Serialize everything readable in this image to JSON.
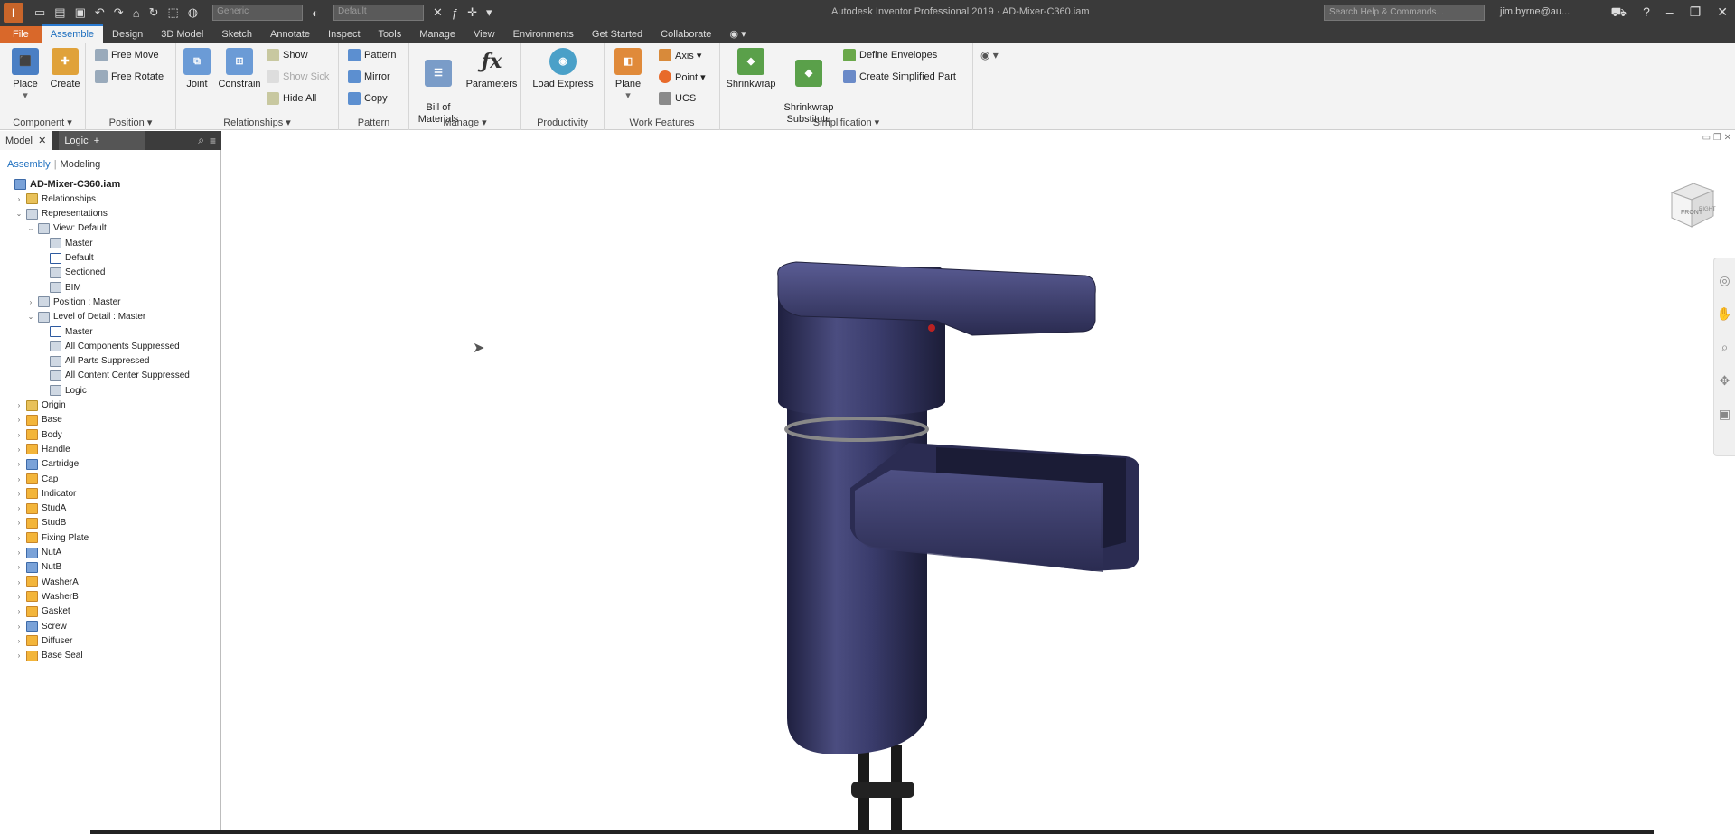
{
  "titlebar": {
    "logo_letter": "I",
    "app_title": "Autodesk Inventor Professional 2019 · AD-Mixer-C360.iam",
    "search_placeholder": "Search Help & Commands...",
    "user": "jim.byrne@au...",
    "qat_combo1": "Generic",
    "qat_combo2": "Default"
  },
  "menu": {
    "tabs": [
      "File",
      "Assemble",
      "Design",
      "3D Model",
      "Sketch",
      "Annotate",
      "Inspect",
      "Tools",
      "Manage",
      "View",
      "Environments",
      "Get Started",
      "Collaborate"
    ]
  },
  "ribbon": {
    "component": {
      "label": "Component ▾",
      "place": "Place",
      "create": "Create"
    },
    "position": {
      "label": "Position ▾",
      "free_move": "Free Move",
      "free_rotate": "Free Rotate"
    },
    "relationships": {
      "label": "Relationships ▾",
      "joint": "Joint",
      "constrain": "Constrain",
      "show": "Show",
      "show_sick": "Show Sick",
      "hide_all": "Hide All"
    },
    "pattern": {
      "label": "Pattern",
      "pattern": "Pattern",
      "mirror": "Mirror",
      "copy": "Copy"
    },
    "manage": {
      "label": "Manage ▾",
      "bom": "Bill of\nMaterials",
      "parameters": "Parameters"
    },
    "productivity": {
      "label": "Productivity",
      "load_express": "Load Express"
    },
    "work_features": {
      "label": "Work Features",
      "plane": "Plane",
      "axis": "Axis ▾",
      "point": "Point ▾",
      "ucs": "UCS"
    },
    "simplification": {
      "label": "Simplification ▾",
      "shrinkwrap": "Shrinkwrap",
      "shrinkwrap_sub": "Shrinkwrap\nSubstitute",
      "define_envelopes": "Define Envelopes",
      "create_simplified": "Create Simplified Part"
    }
  },
  "browser": {
    "tab_model": "Model",
    "tab_logic": "Logic",
    "subtab_assembly": "Assembly",
    "subtab_modeling": "Modeling",
    "items": [
      {
        "label": "AD-Mixer-C360.iam",
        "indent": 0,
        "icon": "asm",
        "tw": ""
      },
      {
        "label": "Relationships",
        "indent": 1,
        "icon": "folder",
        "tw": "›"
      },
      {
        "label": "Representations",
        "indent": 1,
        "icon": "rep",
        "tw": "⌄"
      },
      {
        "label": "View: Default",
        "indent": 2,
        "icon": "rep",
        "tw": "⌄"
      },
      {
        "label": "Master",
        "indent": 3,
        "icon": "rep",
        "tw": ""
      },
      {
        "label": "Default",
        "indent": 3,
        "icon": "chk",
        "tw": ""
      },
      {
        "label": "Sectioned",
        "indent": 3,
        "icon": "rep",
        "tw": ""
      },
      {
        "label": "BIM",
        "indent": 3,
        "icon": "rep",
        "tw": ""
      },
      {
        "label": "Position : Master",
        "indent": 2,
        "icon": "rep",
        "tw": "›"
      },
      {
        "label": "Level of Detail : Master",
        "indent": 2,
        "icon": "rep",
        "tw": "⌄"
      },
      {
        "label": "Master",
        "indent": 3,
        "icon": "chk",
        "tw": ""
      },
      {
        "label": "All Components Suppressed",
        "indent": 3,
        "icon": "rep",
        "tw": ""
      },
      {
        "label": "All Parts Suppressed",
        "indent": 3,
        "icon": "rep",
        "tw": ""
      },
      {
        "label": "All Content Center Suppressed",
        "indent": 3,
        "icon": "rep",
        "tw": ""
      },
      {
        "label": "Logic",
        "indent": 3,
        "icon": "rep",
        "tw": ""
      },
      {
        "label": "Origin",
        "indent": 1,
        "icon": "folder",
        "tw": "›"
      },
      {
        "label": "Base",
        "indent": 1,
        "icon": "part",
        "tw": "›"
      },
      {
        "label": "Body",
        "indent": 1,
        "icon": "part",
        "tw": "›"
      },
      {
        "label": "Handle",
        "indent": 1,
        "icon": "part",
        "tw": "›"
      },
      {
        "label": "Cartridge",
        "indent": 1,
        "icon": "asm",
        "tw": "›"
      },
      {
        "label": "Cap",
        "indent": 1,
        "icon": "part",
        "tw": "›"
      },
      {
        "label": "Indicator",
        "indent": 1,
        "icon": "part",
        "tw": "›"
      },
      {
        "label": "StudA",
        "indent": 1,
        "icon": "part",
        "tw": "›"
      },
      {
        "label": "StudB",
        "indent": 1,
        "icon": "part",
        "tw": "›"
      },
      {
        "label": "Fixing Plate",
        "indent": 1,
        "icon": "part",
        "tw": "›"
      },
      {
        "label": "NutA",
        "indent": 1,
        "icon": "asm",
        "tw": "›"
      },
      {
        "label": "NutB",
        "indent": 1,
        "icon": "asm",
        "tw": "›"
      },
      {
        "label": "WasherA",
        "indent": 1,
        "icon": "part",
        "tw": "›"
      },
      {
        "label": "WasherB",
        "indent": 1,
        "icon": "part",
        "tw": "›"
      },
      {
        "label": "Gasket",
        "indent": 1,
        "icon": "part",
        "tw": "›"
      },
      {
        "label": "Screw",
        "indent": 1,
        "icon": "asm",
        "tw": "›"
      },
      {
        "label": "Diffuser",
        "indent": 1,
        "icon": "part",
        "tw": "›"
      },
      {
        "label": "Base Seal",
        "indent": 1,
        "icon": "part",
        "tw": "›"
      }
    ]
  },
  "viewport": {
    "viewcube_front": "FRONT",
    "viewcube_right": "RIGHT",
    "model_color": "#3d3f6b"
  },
  "colors": {
    "accent": "#1e6fbf",
    "file_tab": "#d9682a",
    "titlebar": "#3a3a3a"
  }
}
